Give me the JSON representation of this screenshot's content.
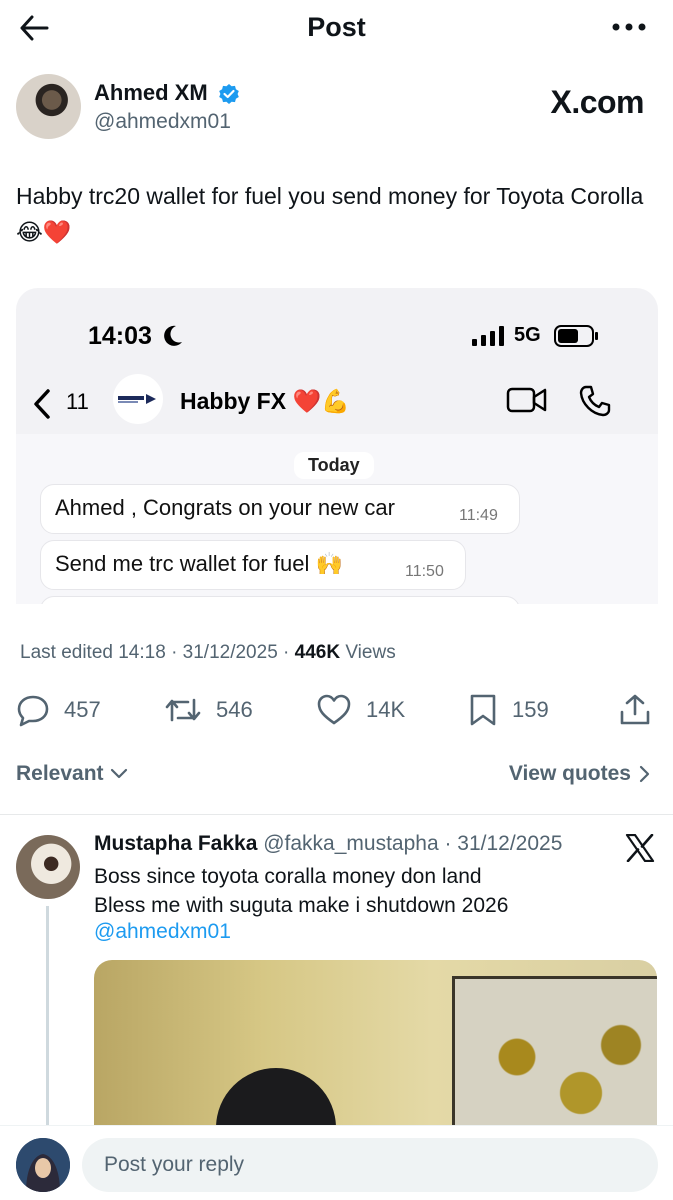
{
  "header": {
    "title": "Post"
  },
  "author": {
    "name": "Ahmed XM",
    "handle": "@ahmedxm01",
    "brand": "X.com",
    "verified": true
  },
  "post": {
    "text": "Habby trc20 wallet for fuel you send money for Toyota Corolla 😂❤️"
  },
  "embed": {
    "time": "14:03",
    "network": "5G",
    "nav_count": "11",
    "contact_name": "Habby FX ❤️💪",
    "date_pill": "Today",
    "messages": [
      {
        "text": "Ahmed , Congrats on your new car",
        "time": "11:49"
      },
      {
        "text": "Send me trc wallet for fuel 🙌",
        "time": "11:50"
      }
    ]
  },
  "meta": {
    "edited": "Last edited 14:18 · 31/12/2025 · ",
    "views_count": "446K",
    "views_label": " Views"
  },
  "actions": {
    "replies": "457",
    "reposts": "546",
    "likes": "14K",
    "bookmarks": "159"
  },
  "filters": {
    "sort": "Relevant",
    "quotes": "View quotes"
  },
  "reply": {
    "name": "Mustapha Fakka",
    "handle_date": " @fakka_mustapha · 31/12/2025",
    "line1": "Boss since toyota coralla money don land",
    "line2": "Bless me with suguta make i shutdown 2026",
    "mention": "@ahmedxm01"
  },
  "composer": {
    "placeholder": "Post your reply"
  },
  "colors": {
    "accent": "#1d9bf0",
    "muted": "#536471",
    "text": "#0f1419"
  }
}
